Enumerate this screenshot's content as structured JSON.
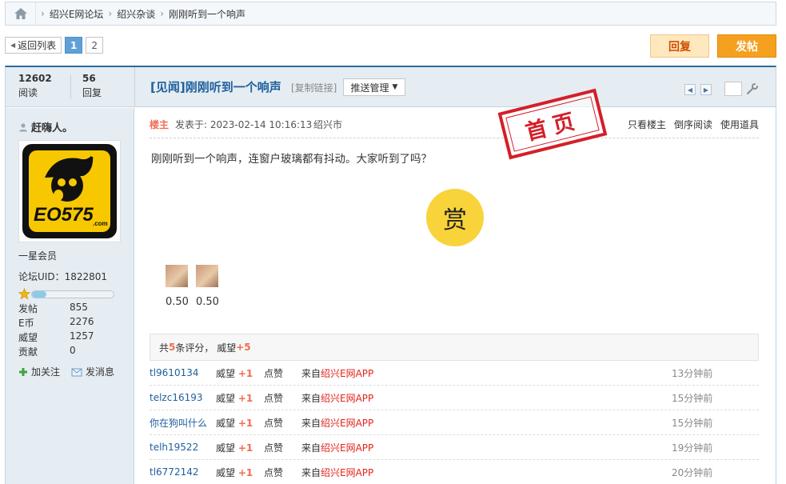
{
  "breadcrumb": {
    "items": [
      "绍兴E网论坛",
      "绍兴杂谈",
      "刚刚听到一个响声"
    ]
  },
  "pager": {
    "back_label": "返回列表",
    "pages": [
      "1",
      "2"
    ]
  },
  "buttons": {
    "reply": "回复",
    "post": "发帖"
  },
  "thread": {
    "views_count": "12602",
    "views_label": "阅读",
    "replies_count": "56",
    "replies_label": "回复",
    "title": "[见闻]刚刚听到一个响声",
    "copy_link": "[复制链接]",
    "push_menu": "推送管理"
  },
  "user": {
    "name": "赶嗨人。",
    "avatar_text": "EO575",
    "avatar_sub": ".com",
    "rank": "一星会员",
    "uid": "论坛UID：1822801",
    "stats": [
      {
        "k": "发帖",
        "v": "855"
      },
      {
        "k": "E币",
        "v": "2276"
      },
      {
        "k": "威望",
        "v": "1257"
      },
      {
        "k": "贡献",
        "v": "0"
      }
    ],
    "follow": "加关注",
    "message": "发消息",
    "level_progress": 0.18
  },
  "post": {
    "floor": "楼主",
    "posted": "发表于: 2023-02-14 10:16:13",
    "city": "绍兴市",
    "links": [
      "只看楼主",
      "倒序阅读",
      "使用道具"
    ],
    "stamp": "首页",
    "content": "刚刚听到一个响声，连窗户玻璃都有抖动。大家听到了吗？",
    "reward_label": "赏",
    "rewards": [
      "0.50",
      "0.50"
    ]
  },
  "rating": {
    "prefix": "共",
    "count": "5",
    "mid": "条评分，  威望",
    "total": "+5",
    "rows": [
      {
        "user": "tl9610134",
        "w": "威望",
        "plus": "+1",
        "like": "点赞",
        "from": "来自",
        "app": "绍兴E网APP",
        "time": "13分钟前"
      },
      {
        "user": "telzc16193",
        "w": "威望",
        "plus": "+1",
        "like": "点赞",
        "from": "来自",
        "app": "绍兴E网APP",
        "time": "15分钟前"
      },
      {
        "user": "你在狗叫什么",
        "w": "威望",
        "plus": "+1",
        "like": "点赞",
        "from": "来自",
        "app": "绍兴E网APP",
        "time": "15分钟前"
      },
      {
        "user": "telh19522",
        "w": "威望",
        "plus": "+1",
        "like": "点赞",
        "from": "来自",
        "app": "绍兴E网APP",
        "time": "19分钟前"
      },
      {
        "user": "tl6772142",
        "w": "威望",
        "plus": "+1",
        "like": "点赞",
        "from": "来自",
        "app": "绍兴E网APP",
        "time": "20分钟前"
      }
    ]
  },
  "colors": {
    "accent": "#1f5f9c",
    "highlight": "#f26c4f",
    "app": "#e4231a",
    "post_button": "#f5a11f"
  }
}
